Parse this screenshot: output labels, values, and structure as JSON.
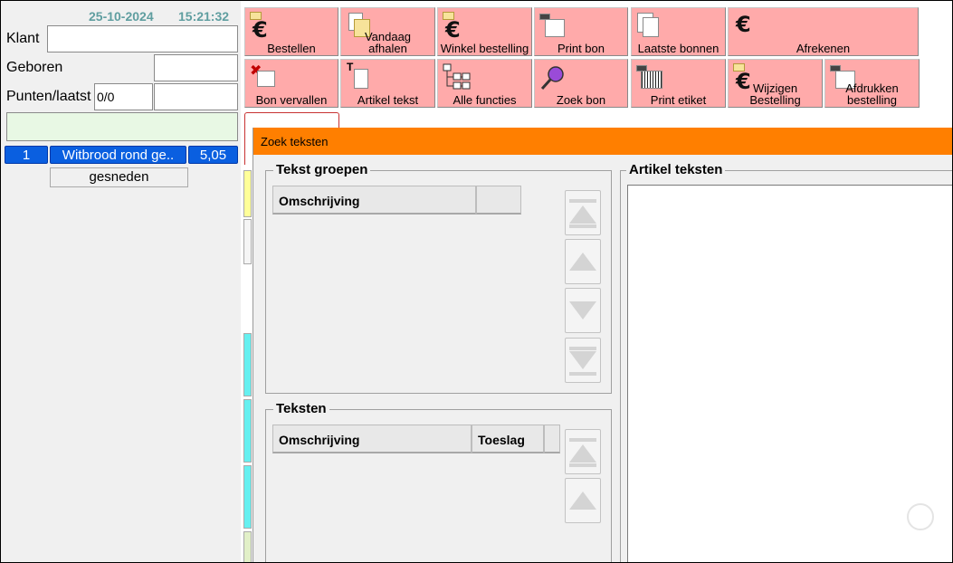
{
  "header": {
    "date": "25-10-2024",
    "time": "15:21:32"
  },
  "customer": {
    "klant_label": "Klant",
    "geboren_label": "Geboren",
    "punten_label": "Punten/laatst",
    "punten_value": "0/0"
  },
  "order_line": {
    "qty": "1",
    "description": "Witbrood rond ge..",
    "price": "5,05",
    "option": "gesneden"
  },
  "toolbar": {
    "bestellen": "Bestellen",
    "vandaag_1": "Vandaag",
    "vandaag_2": "afhalen",
    "winkel_bestelling": "Winkel bestelling",
    "print_bon": "Print bon",
    "laatste_bonnen": "Laatste bonnen",
    "afrekenen": "Afrekenen",
    "bon_vervallen": "Bon vervallen",
    "artikel_tekst": "Artikel tekst",
    "alle_functies": "Alle functies",
    "zoek_bon": "Zoek bon",
    "print_etiket": "Print etiket",
    "wijzigen_1": "Wijzigen",
    "wijzigen_2": "Bestelling",
    "afdrukken_1": "Afdrukken",
    "afdrukken_2": "bestelling"
  },
  "dialog": {
    "title": "Zoek teksten",
    "tekst_groepen": {
      "title": "Tekst groepen",
      "col_omschrijving": "Omschrijving"
    },
    "teksten": {
      "title": "Teksten",
      "col_omschrijving": "Omschrijving",
      "col_toeslag": "Toeslag"
    },
    "artikel_teksten": {
      "title": "Artikel teksten"
    }
  },
  "colors": {
    "button_bg": "#ffaaaa",
    "dialog_title_bg": "#ff7f00",
    "order_line_bg": "#0a5fe0",
    "datetime_text": "#5f9ea0"
  }
}
